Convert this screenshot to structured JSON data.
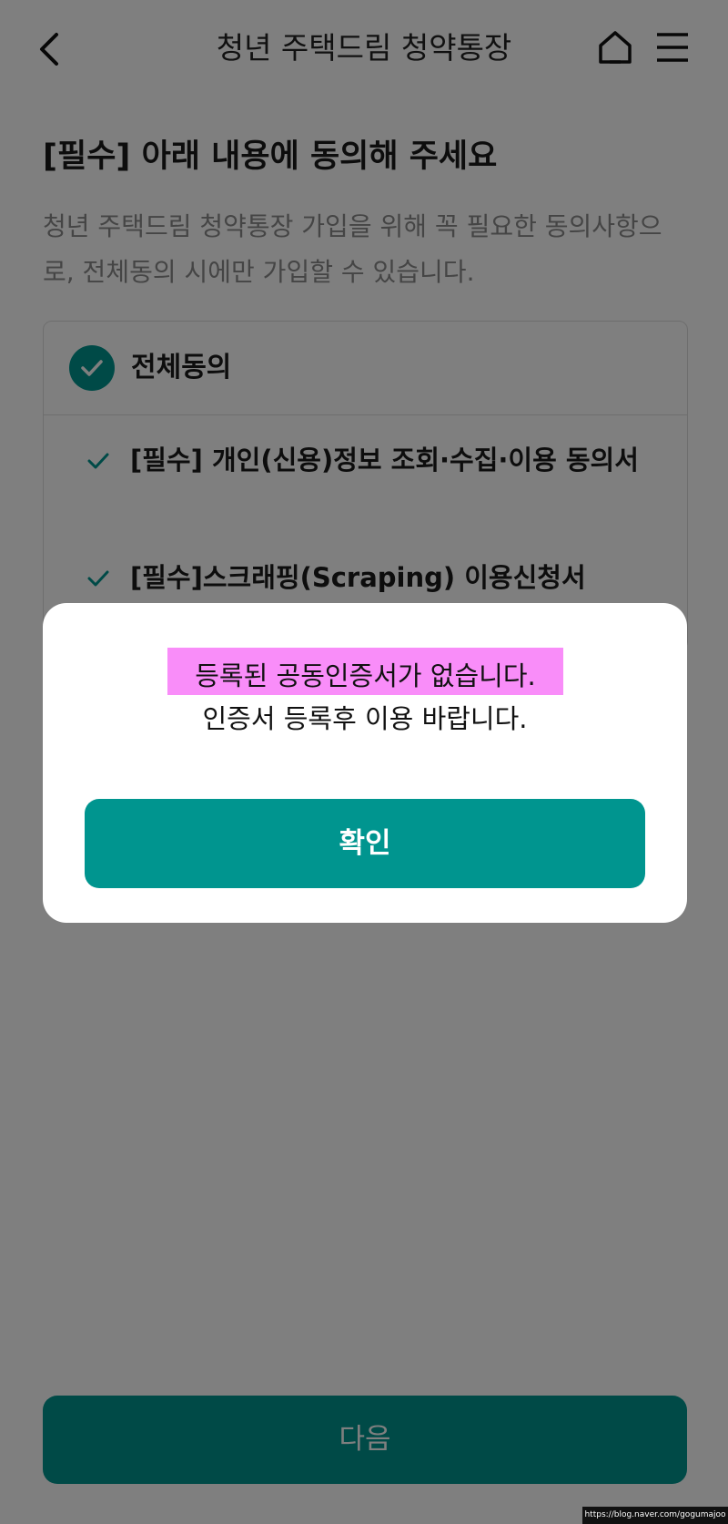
{
  "header": {
    "title": "청년 주택드림 청약통장",
    "back_icon": "chevron-left-icon",
    "home_icon": "home-icon",
    "menu_icon": "hamburger-menu-icon"
  },
  "content": {
    "title": "[필수] 아래 내용에 동의해 주세요",
    "description": "청년 주택드림 청약통장 가입을 위해 꼭 필요한 동의사항으로, 전체동의 시에만 가입할 수 있습니다."
  },
  "agreements": {
    "all_label": "전체동의",
    "all_checked": true,
    "items": [
      {
        "label": "[필수] 개인(신용)정보 조회·수집·이용 동의서",
        "checked": true
      },
      {
        "label": "[필수]스크래핑(Scraping) 이용신청서",
        "checked": true
      }
    ]
  },
  "next_button": {
    "label": "다음"
  },
  "dialog": {
    "message_line1": "등록된 공동인증서가 없습니다.",
    "message_line2": "인증서 등록후 이용 바랍니다.",
    "highlight_color": "#f98df9",
    "confirm_label": "확인"
  },
  "watermark": "https://blog.naver.com/gogumajoo",
  "colors": {
    "accent": "#00958f"
  }
}
